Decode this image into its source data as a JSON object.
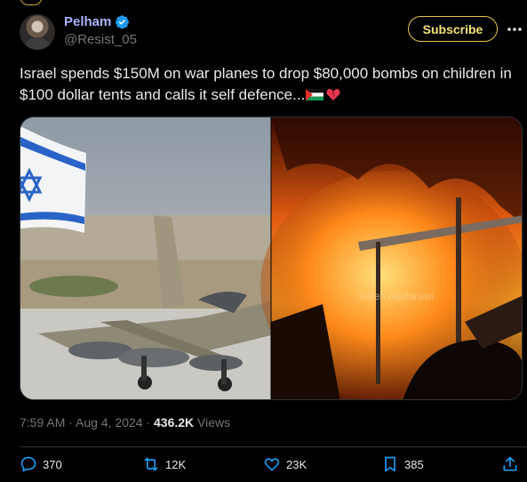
{
  "author": {
    "name": "Pelham",
    "handle": "@Resist_05",
    "subscribe_label": "Subscribe"
  },
  "icons": {
    "verified": "verified-badge-icon",
    "more": "more-dots-icon",
    "reply": "reply-icon",
    "repost": "repost-icon",
    "like": "heart-icon",
    "bookmark": "bookmark-icon",
    "share": "share-icon",
    "flag": "palestine-flag-emoji",
    "broken_heart": "broken-heart-emoji"
  },
  "tweet": {
    "text": "Israel spends $150M on war planes to drop $80,000 bombs on children in $100 dollar tents and calls it self defence...",
    "media_watermark": "Saleh Aljafarawi"
  },
  "meta": {
    "time": "7:59 AM",
    "separator1": " · ",
    "date": "Aug 4, 2024",
    "separator2": " · ",
    "views_count": "436.2K",
    "views_label": " Views"
  },
  "actions": {
    "replies": "370",
    "reposts": "12K",
    "likes": "23K",
    "bookmarks": "385"
  },
  "colors": {
    "accent_name": "#a9b4ff",
    "verified": "#1d9bf0",
    "subscribe": "#e6c64a",
    "action_icon": "#1d9bf0"
  }
}
